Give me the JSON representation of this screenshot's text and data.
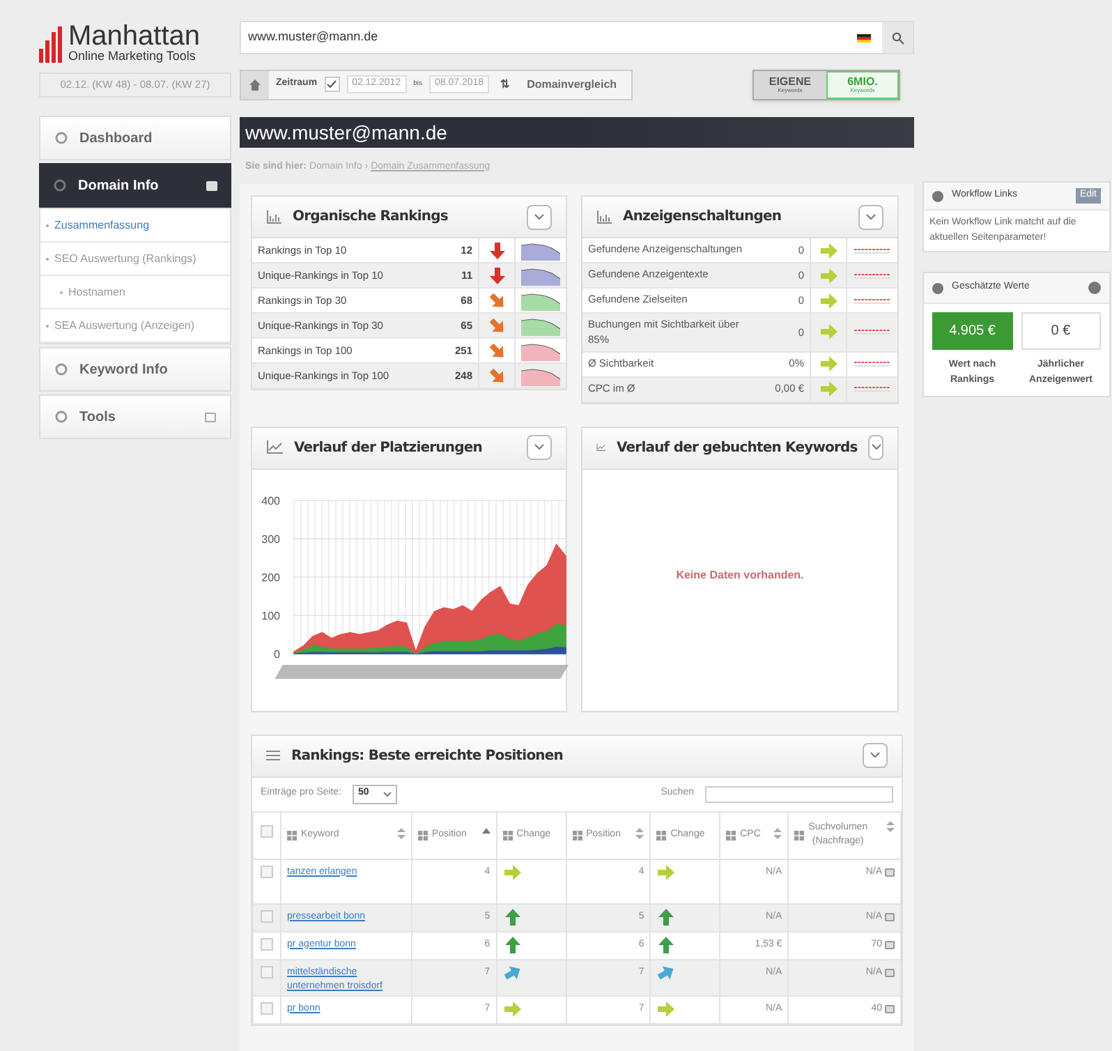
{
  "logo": {
    "name": "Manhattan",
    "tagline": "Online Marketing Tools"
  },
  "period_label": "02.12. (KW 48) - 08.07. (KW 27)",
  "search": {
    "value": "www.muster@mann.de"
  },
  "toolbar": {
    "zeitraum_label": "Zeitraum",
    "zeitraum_checked": true,
    "date_from": "02.12.2012",
    "bis": "bis",
    "date_to": "08.07.2018",
    "swap": "⇅",
    "compare": "Domainvergleich"
  },
  "keyword_toggle": [
    {
      "label": "EIGENE",
      "sub": "Keywords",
      "selected": false
    },
    {
      "label": "6MIO.",
      "sub": "Keywords",
      "selected": true
    }
  ],
  "sidebar": {
    "items": [
      {
        "label": "Dashboard",
        "selected": false
      },
      {
        "label": "Domain Info",
        "selected": true,
        "expanded": true,
        "children": [
          {
            "label": "Zusammenfassung",
            "selected": true
          },
          {
            "label": "SEO Auswertung (Rankings)",
            "selected": false,
            "children": [
              {
                "label": "Hostnamen",
                "selected": false
              }
            ]
          },
          {
            "label": "SEA Auswertung (Anzeigen)",
            "selected": false
          }
        ]
      },
      {
        "label": "Keyword Info",
        "selected": false
      },
      {
        "label": "Tools",
        "selected": false,
        "expanded": false
      }
    ]
  },
  "page_title": "www.muster@mann.de",
  "breadcrumb": {
    "prefix": "Sie sind hier:",
    "items": [
      "Domain Info",
      "Domain Zusammenfassung"
    ],
    "separator": "›"
  },
  "organic": {
    "title": "Organische Rankings",
    "rows": [
      {
        "label": "Rankings in Top 10",
        "value": "12",
        "kind": "down",
        "color": "#a9acd8"
      },
      {
        "label": "Unique-Rankings in Top 10",
        "value": "11",
        "kind": "down",
        "color": "#a9acd8"
      },
      {
        "label": "Rankings in Top 30",
        "value": "68",
        "kind": "downright",
        "color": "#a6dca6"
      },
      {
        "label": "Unique-Rankings in Top 30",
        "value": "65",
        "kind": "downright",
        "color": "#a6dca6"
      },
      {
        "label": "Rankings in Top 100",
        "value": "251",
        "kind": "downright",
        "color": "#f2b4bb"
      },
      {
        "label": "Unique-Rankings in Top 100",
        "value": "248",
        "kind": "downright",
        "color": "#f2b4bb"
      }
    ]
  },
  "ads": {
    "title": "Anzeigenschaltungen",
    "rows": [
      {
        "label": "Gefundene Anzeigenschaltungen",
        "value": "0",
        "kind": "right"
      },
      {
        "label": "Gefundene Anzeigentexte",
        "value": "0",
        "kind": "right"
      },
      {
        "label": "Gefundene Zielseiten",
        "value": "0",
        "kind": "right"
      },
      {
        "label": "Buchungen mit Sichtbarkeit über 85%",
        "value": "0",
        "kind": "right"
      },
      {
        "label": "Ø Sichtbarkeit",
        "value": "0%",
        "kind": "right"
      },
      {
        "label": "CPC im Ø",
        "value": "0,00 €",
        "kind": "right"
      }
    ]
  },
  "placements": {
    "title": "Verlauf der Platzierungen",
    "y_labels": [
      "400",
      "300",
      "200",
      "100",
      "0"
    ]
  },
  "booked": {
    "title": "Verlauf der gebuchten Keywords",
    "empty": "Keine Daten vorhanden."
  },
  "workflow": {
    "title": "Workflow Links",
    "edit": "Edit",
    "text": "Kein Workflow Link matcht auf die aktuellen Seitenparameter!"
  },
  "estimates": {
    "title": "Geschätzte Werte",
    "values": [
      {
        "value": "4.905 €",
        "label": "Wert nach Rankings",
        "kind": "primary"
      },
      {
        "value": "0 €",
        "label": "Jährlicher Anzeigenwert",
        "kind": "plain"
      }
    ]
  },
  "rankings": {
    "title": "Rankings: Beste erreichte Positionen",
    "per_page_label": "Einträge pro Seite:",
    "per_page": "50",
    "search_label": "Suchen",
    "select_all_checked": false,
    "columns": [
      {
        "label": "Keyword",
        "kind": "sortable"
      },
      {
        "label": "Position",
        "kind": "sorted"
      },
      {
        "label": "Change",
        "kind": "plain"
      },
      {
        "label": "Position",
        "kind": "sortable"
      },
      {
        "label": "Change",
        "kind": "plain"
      },
      {
        "label": "CPC",
        "kind": "sortable"
      },
      {
        "label": "Suchvolumen",
        "sub": "(Nachfrage)",
        "kind": "sortable"
      }
    ],
    "rows": [
      {
        "checked": false,
        "keyword": "tanzen erlangen",
        "pos1": "4",
        "changes": [
          {
            "kind": "right"
          },
          {
            "kind": "right"
          }
        ],
        "pos2": "4",
        "cpc": "N/A",
        "volume": "N/A"
      },
      {
        "checked": false,
        "keyword": "pressearbeit bonn",
        "pos1": "5",
        "changes": [
          {
            "kind": "up"
          },
          {
            "kind": "up"
          }
        ],
        "pos2": "5",
        "cpc": "N/A",
        "volume": "N/A"
      },
      {
        "checked": false,
        "keyword": "pr agentur bonn",
        "pos1": "6",
        "changes": [
          {
            "kind": "up"
          },
          {
            "kind": "up"
          }
        ],
        "pos2": "6",
        "cpc": "1,53 €",
        "volume": "70"
      },
      {
        "checked": false,
        "keyword": "mittelständische unternehmen troisdorf",
        "pos1": "7",
        "changes": [
          {
            "kind": "upright"
          },
          {
            "kind": "upright"
          }
        ],
        "pos2": "7",
        "cpc": "N/A",
        "volume": "N/A"
      },
      {
        "checked": false,
        "keyword": "pr bonn",
        "pos1": "7",
        "changes": [
          {
            "kind": "right"
          },
          {
            "kind": "right"
          }
        ],
        "pos2": "7",
        "cpc": "N/A",
        "volume": "40"
      }
    ]
  }
}
